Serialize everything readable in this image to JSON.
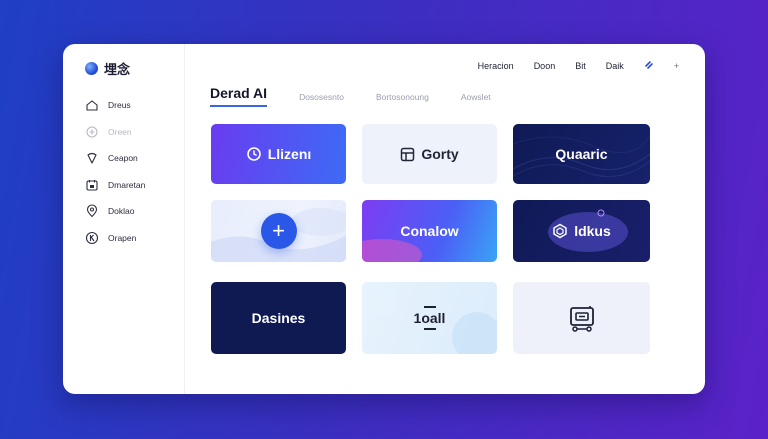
{
  "app": {
    "title": "埋念"
  },
  "sidebar": {
    "items": [
      {
        "label": "Dreus",
        "icon": "home-icon"
      },
      {
        "label": "Oreen",
        "icon": "plus-circle-icon"
      },
      {
        "label": "Ceapon",
        "icon": "location-pin-icon"
      },
      {
        "label": "Dmaretan",
        "icon": "calendar-icon"
      },
      {
        "label": "Doklao",
        "icon": "map-pin-icon"
      },
      {
        "label": "Orapen",
        "icon": "k-circle-icon"
      }
    ]
  },
  "topnav": {
    "links": [
      "Heracion",
      "Doon",
      "Bit",
      "Daik"
    ],
    "extra": "+"
  },
  "tabs": [
    "Derad AI",
    "Dososesnto",
    "Bortosonoung",
    "Aowslet"
  ],
  "cards": [
    {
      "label": "Llizenı",
      "icon": "clock-icon"
    },
    {
      "label": "Gorty",
      "icon": "frame-icon"
    },
    {
      "label": "Quaaric",
      "icon": ""
    },
    {
      "label": "",
      "icon": "plus-icon"
    },
    {
      "label": "Conalow",
      "icon": ""
    },
    {
      "label": "ldkus",
      "icon": "hexagon-icon"
    },
    {
      "label": "Dasines",
      "icon": ""
    },
    {
      "label": "1oall",
      "icon": ""
    },
    {
      "label": "",
      "icon": "robot-icon"
    }
  ],
  "colors": {
    "accent": "#3b63e6",
    "dark_card": "#0f1a56",
    "background_start": "#1f3fc4",
    "background_end": "#5a22c8"
  }
}
